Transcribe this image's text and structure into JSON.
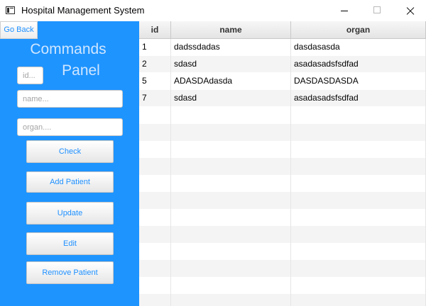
{
  "window": {
    "title": "Hospital Management System",
    "icon": "app-window-icon"
  },
  "panel": {
    "go_back": "Go Back",
    "title_line1": "Commands",
    "title_line2": "Panel",
    "id_placeholder": "id...",
    "name_placeholder": "name...",
    "organ_placeholder": "organ....",
    "buttons": {
      "check": "Check",
      "add": "Add Patient",
      "update": "Update",
      "edit": "Edit",
      "remove": "Remove Patient"
    },
    "background_color": "#1e94ff",
    "button_text_color": "#1e90ff"
  },
  "table": {
    "columns": [
      "id",
      "name",
      "organ"
    ],
    "rows": [
      {
        "id": "1",
        "name": "dadssdadas",
        "organ": "dasdasasda"
      },
      {
        "id": "2",
        "name": "sdasd",
        "organ": "asadasadsfsdfad"
      },
      {
        "id": "5",
        "name": "ADASDAdasda",
        "organ": "DASDASDASDA"
      },
      {
        "id": "7",
        "name": "sdasd",
        "organ": "asadasadsfsdfad"
      }
    ]
  }
}
